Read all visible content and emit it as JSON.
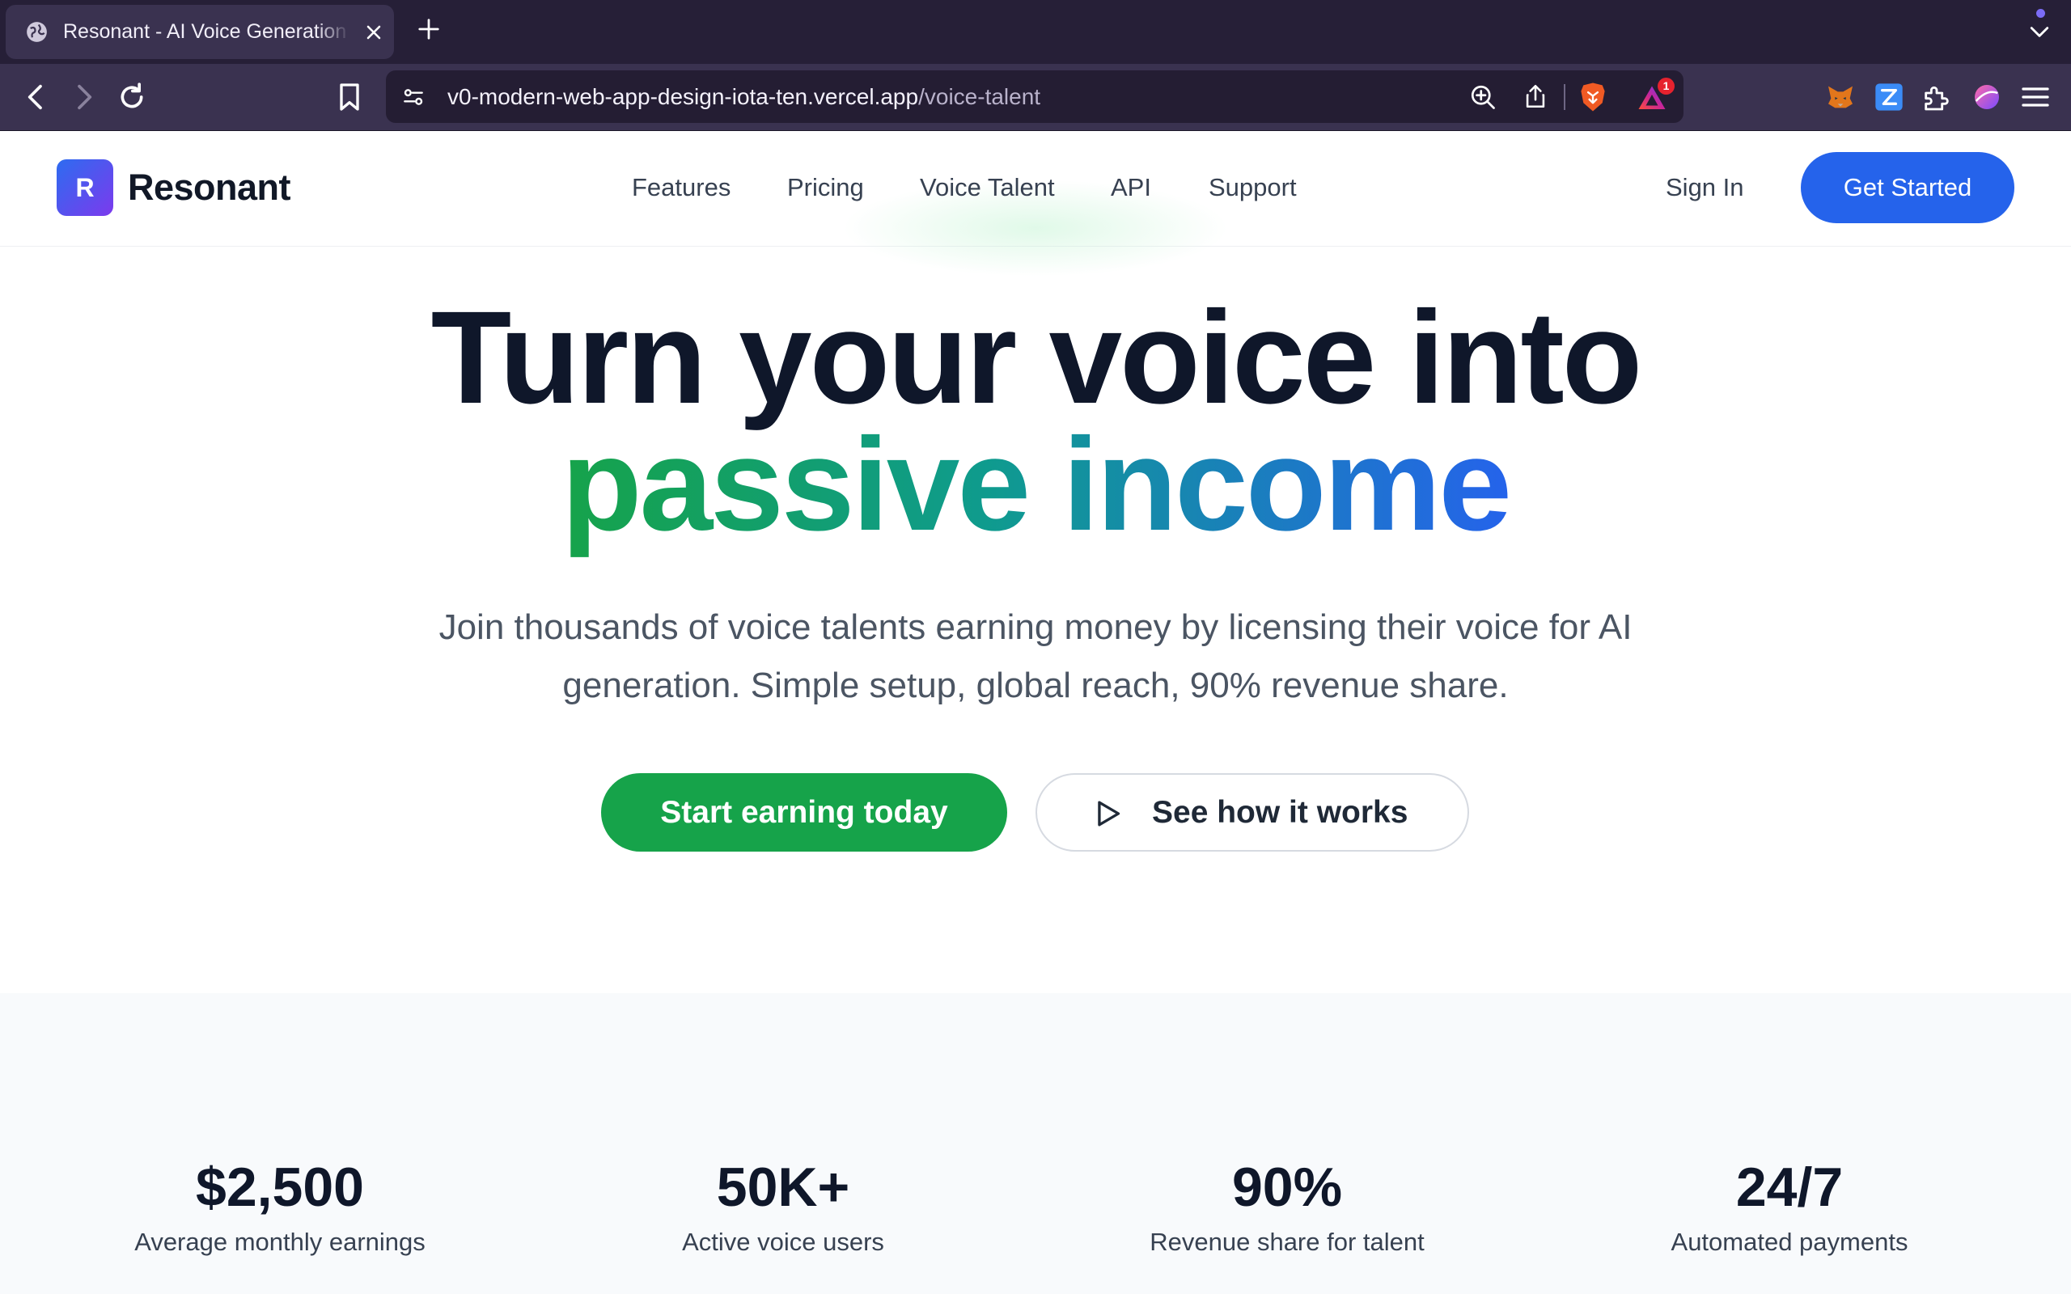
{
  "browser": {
    "tab": {
      "title": "Resonant - AI Voice Generation"
    },
    "url": {
      "host": "v0-modern-web-app-design-iota-ten.vercel.app",
      "path": "/voice-talent"
    },
    "rewards_badge": "1"
  },
  "header": {
    "logo_letter": "R",
    "brand": "Resonant",
    "nav": [
      {
        "label": "Features"
      },
      {
        "label": "Pricing"
      },
      {
        "label": "Voice Talent"
      },
      {
        "label": "API"
      },
      {
        "label": "Support"
      }
    ],
    "sign_in": "Sign In",
    "get_started": "Get Started"
  },
  "hero": {
    "line1": "Turn your voice into",
    "line2": "passive income",
    "subtitle": "Join thousands of voice talents earning money by licensing their voice for AI generation. Simple setup, global reach, 90% revenue share.",
    "primary_cta": "Start earning today",
    "secondary_cta": "See how it works",
    "gradient_colors": [
      "#16a34a",
      "#0f9b8e",
      "#2563eb"
    ]
  },
  "stats": [
    {
      "value": "$2,500",
      "label": "Average monthly earnings"
    },
    {
      "value": "50K+",
      "label": "Active voice users"
    },
    {
      "value": "90%",
      "label": "Revenue share for talent"
    },
    {
      "value": "24/7",
      "label": "Automated payments"
    }
  ],
  "colors": {
    "primary_blue": "#2563eb",
    "primary_green": "#16a34a",
    "heading": "#0f172a",
    "chrome_dark": "#261f37"
  }
}
